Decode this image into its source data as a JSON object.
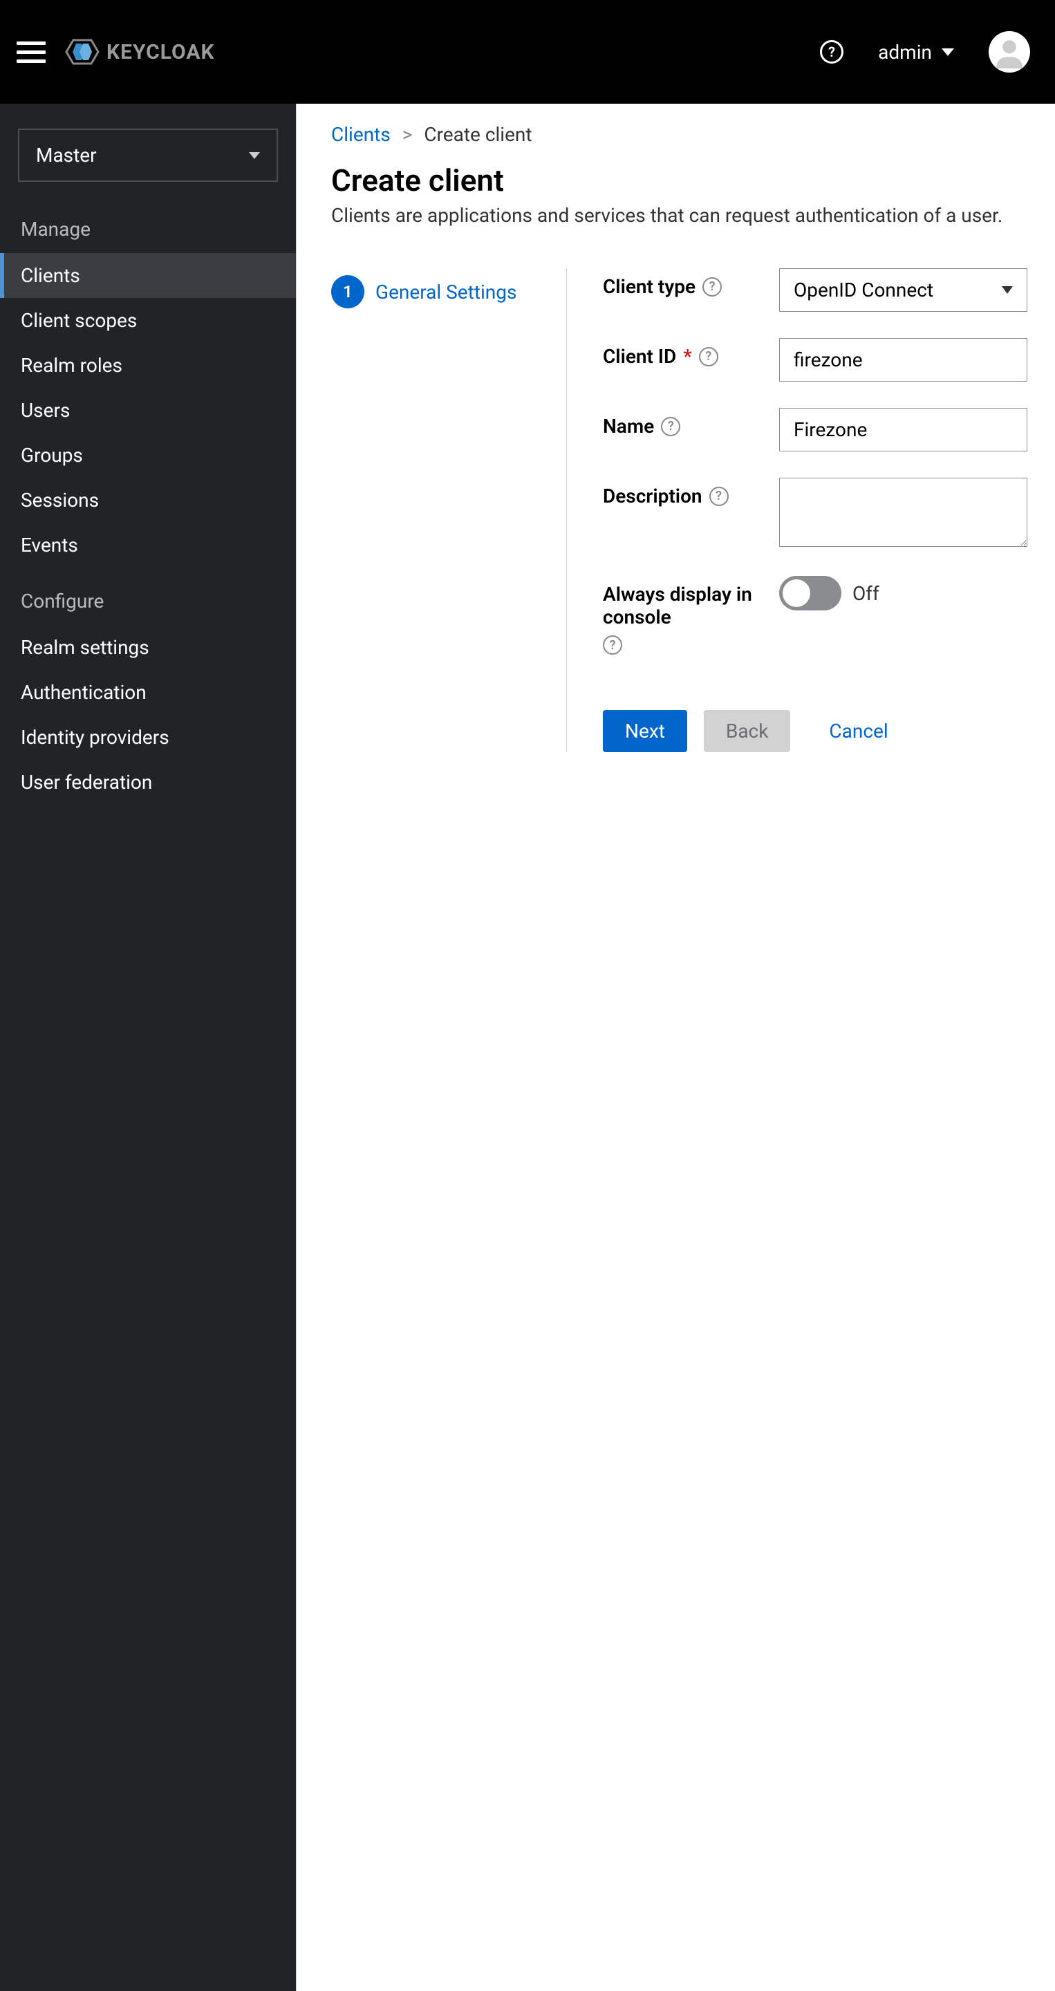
{
  "header": {
    "logo_text": "KEYCLOAK",
    "user_name": "admin"
  },
  "sidebar": {
    "realm": "Master",
    "sections": [
      {
        "title": "Manage",
        "items": [
          {
            "label": "Clients",
            "active": true
          },
          {
            "label": "Client scopes",
            "active": false
          },
          {
            "label": "Realm roles",
            "active": false
          },
          {
            "label": "Users",
            "active": false
          },
          {
            "label": "Groups",
            "active": false
          },
          {
            "label": "Sessions",
            "active": false
          },
          {
            "label": "Events",
            "active": false
          }
        ]
      },
      {
        "title": "Configure",
        "items": [
          {
            "label": "Realm settings",
            "active": false
          },
          {
            "label": "Authentication",
            "active": false
          },
          {
            "label": "Identity providers",
            "active": false
          },
          {
            "label": "User federation",
            "active": false
          }
        ]
      }
    ]
  },
  "breadcrumb": {
    "link": "Clients",
    "current": "Create client"
  },
  "page": {
    "title": "Create client",
    "subtitle": "Clients are applications and services that can request authentication of a user."
  },
  "wizard": {
    "step_number": "1",
    "step_label": "General Settings"
  },
  "form": {
    "client_type": {
      "label": "Client type",
      "value": "OpenID Connect"
    },
    "client_id": {
      "label": "Client ID",
      "value": "firezone"
    },
    "name": {
      "label": "Name",
      "value": "Firezone"
    },
    "description": {
      "label": "Description",
      "value": ""
    },
    "always_display": {
      "label": "Always display in console",
      "value": "Off"
    }
  },
  "buttons": {
    "next": "Next",
    "back": "Back",
    "cancel": "Cancel"
  }
}
